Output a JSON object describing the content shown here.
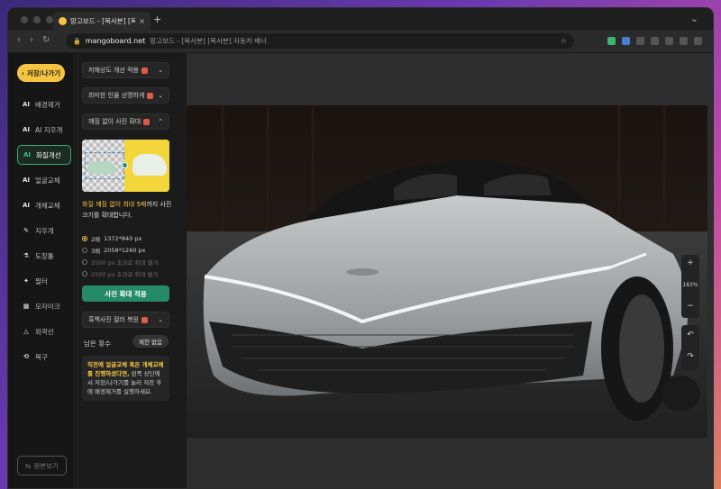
{
  "browser": {
    "tab_title": "망고보드 - [복사본] [복사본] 자동",
    "tab_close": "×",
    "new_tab": "+",
    "url_host": "mangoboard.net",
    "url_path": "망고보드 - [복사본] [복사본] 자동차 배너"
  },
  "sidebar": {
    "save_exit": "저장/나가기",
    "items": [
      {
        "icon": "AI",
        "label": "배경제거"
      },
      {
        "icon": "AI",
        "label": "AI 지우개"
      },
      {
        "icon": "AI",
        "label": "화질개선"
      },
      {
        "icon": "AI",
        "label": "얼굴교체"
      },
      {
        "icon": "AI",
        "label": "개체교체"
      },
      {
        "icon": "✎",
        "label": "지우개"
      },
      {
        "icon": "⚗",
        "label": "도장툴"
      },
      {
        "icon": "✦",
        "label": "필터"
      },
      {
        "icon": "▦",
        "label": "모자이크"
      },
      {
        "icon": "△",
        "label": "외곽선"
      },
      {
        "icon": "⟲",
        "label": "복구"
      }
    ],
    "original_view": "원본보기"
  },
  "panel": {
    "dropdown1": "저해상도 개선 적용",
    "dropdown2": "희미한 인물 선명하게",
    "dropdown3": "깨짐 없이 사진 확대",
    "desc_highlight": "화질 깨짐 없이 최대 5배",
    "desc_rest": "까지 사진 크기를 확대합니다.",
    "options": [
      {
        "label": "2배",
        "size": "1372*840 px",
        "selected": true,
        "enabled": true
      },
      {
        "label": "3배",
        "size": "2058*1260 px",
        "selected": false,
        "enabled": true
      },
      {
        "label": "",
        "size": "2500 px 초과로 확대 불가",
        "selected": false,
        "enabled": false
      },
      {
        "label": "",
        "size": "2500 px 초과로 확대 불가",
        "selected": false,
        "enabled": false
      }
    ],
    "apply_button": "사진 확대 적용",
    "dropdown4": "흑백사진 컬러 복원",
    "remaining_label": "남은 횟수",
    "remaining_value": "제한 없음",
    "notice_highlight": "직전에 얼굴교체 혹은 개체교체를 진행하셨다면,",
    "notice_rest": " 왼쪽 상단에서 저장/나가기를 눌러 저장 후에 배경제거를 실행하세요."
  },
  "zoom": {
    "plus": "+",
    "level": "183%",
    "minus": "−",
    "undo": "↶",
    "redo": "↷"
  },
  "colors": {
    "accent_yellow": "#f5c542",
    "accent_green": "#258a68",
    "badge_red": "#e05a4a"
  }
}
